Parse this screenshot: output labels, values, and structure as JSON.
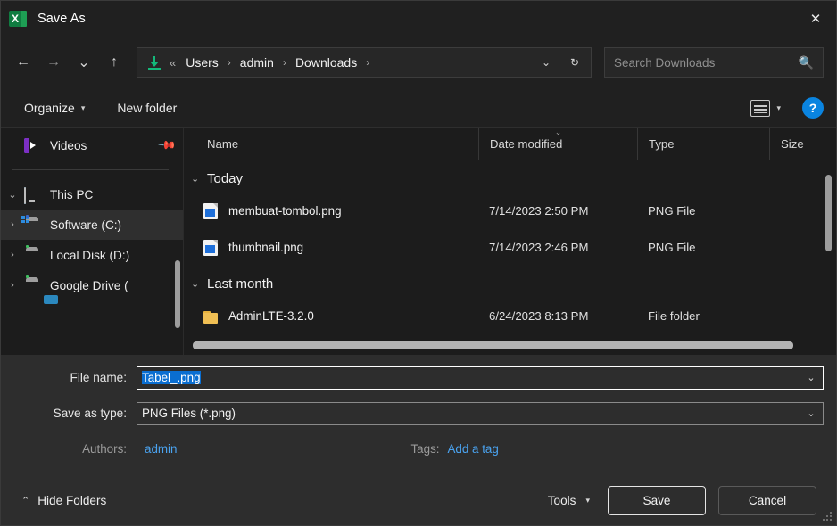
{
  "window": {
    "title": "Save As",
    "app_icon": "excel-icon",
    "close_label": "✕"
  },
  "nav": {
    "back": "←",
    "forward": "→",
    "recent": "⌄",
    "up": "↑",
    "overflow": "«",
    "breadcrumbs": [
      "Users",
      "admin",
      "Downloads"
    ],
    "separator": "›",
    "previous_locations": "⌄",
    "refresh": "↻",
    "location_icon": "downloads-arrow-icon"
  },
  "search": {
    "placeholder": "Search Downloads",
    "value": "",
    "icon": "search-icon"
  },
  "toolbar": {
    "organize": "Organize",
    "new_folder": "New folder",
    "caret": "▾",
    "view_icon": "list-view-icon",
    "view_caret": "▾",
    "help": "?"
  },
  "sidebar": {
    "items": [
      {
        "label": "Videos",
        "icon": "video-folder-icon",
        "pinned": true,
        "expander": "",
        "indent": 1
      },
      {
        "label": "This PC",
        "icon": "this-pc-icon",
        "pinned": false,
        "expander": "⌄",
        "indent": 0
      },
      {
        "label": "Software (C:)",
        "icon": "windows-drive-icon",
        "pinned": false,
        "expander": "›",
        "indent": 1,
        "selected": true
      },
      {
        "label": "Local Disk (D:)",
        "icon": "drive-icon",
        "pinned": false,
        "expander": "›",
        "indent": 1
      },
      {
        "label": "Google Drive (",
        "icon": "drive-icon",
        "pinned": false,
        "expander": "›",
        "indent": 1
      }
    ],
    "pin_icon": "pin-icon"
  },
  "filelist": {
    "columns": [
      "Name",
      "Date modified",
      "Type",
      "Size"
    ],
    "sort_indicator": "⌄",
    "groups": [
      {
        "label": "Today",
        "chevron": "⌄",
        "rows": [
          {
            "name": "membuat-tombol.png",
            "date": "7/14/2023 2:50 PM",
            "type": "PNG File",
            "size": "",
            "icon": "png-file-icon"
          },
          {
            "name": "thumbnail.png",
            "date": "7/14/2023 2:46 PM",
            "type": "PNG File",
            "size": "",
            "icon": "png-file-icon"
          }
        ]
      },
      {
        "label": "Last month",
        "chevron": "⌄",
        "rows": [
          {
            "name": "AdminLTE-3.2.0",
            "date": "6/24/2023 8:13 PM",
            "type": "File folder",
            "size": "",
            "icon": "folder-icon"
          }
        ]
      }
    ]
  },
  "form": {
    "file_name_label": "File name:",
    "file_name_value": "Tabel_.png",
    "save_as_type_label": "Save as type:",
    "save_as_type_value": "PNG Files (*.png)",
    "chevron": "⌄",
    "authors_label": "Authors:",
    "authors_value": "admin",
    "tags_label": "Tags:",
    "tags_value": "Add a tag"
  },
  "footer": {
    "hide_folders": "Hide Folders",
    "hide_folders_chevron": "⌃",
    "tools": "Tools",
    "tools_caret": "▾",
    "save": "Save",
    "cancel": "Cancel"
  },
  "colors": {
    "window_bg": "#202020",
    "pane_bg": "#1c1c1c",
    "form_bg": "#2d2d2d",
    "accent_blue": "#0a6ed1",
    "link_blue": "#4aa3f0",
    "help_blue": "#0a84e0",
    "download_green": "#14b87a",
    "folder_yellow": "#f0bf54"
  }
}
